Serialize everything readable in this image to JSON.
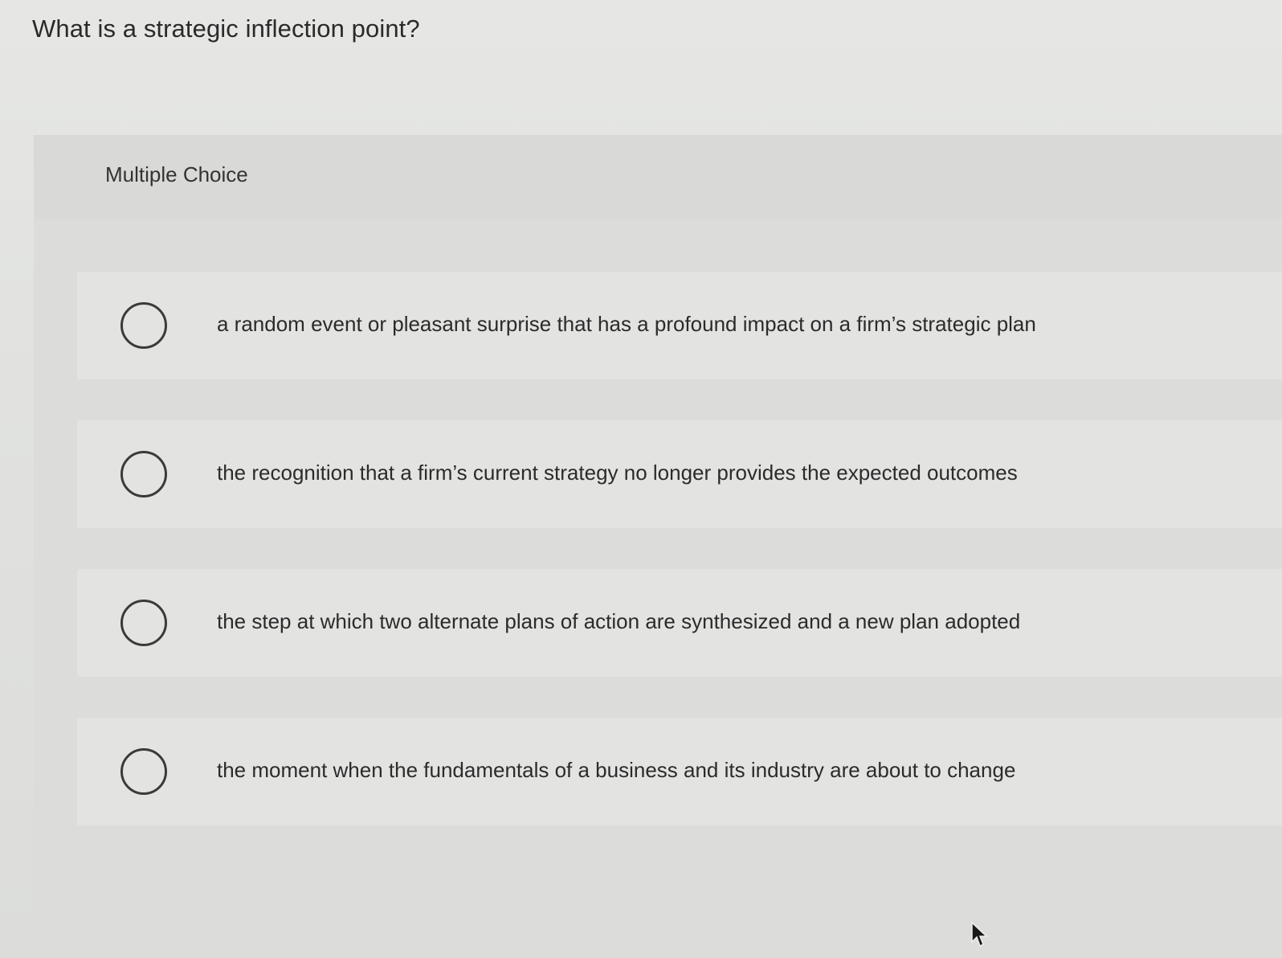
{
  "question": {
    "text": "What is a strategic inflection point?"
  },
  "panel": {
    "title": "Multiple Choice",
    "options": [
      {
        "label": "a random event or pleasant surprise that has a profound impact on a firm’s strategic plan"
      },
      {
        "label": "the recognition that a firm’s current strategy no longer provides the expected outcomes"
      },
      {
        "label": "the step at which two alternate plans of action are synthesized and a new plan adopted"
      },
      {
        "label": "the moment when the fundamentals of a business and its industry are about to change"
      }
    ]
  },
  "icons": {
    "radio": "radio-unchecked-icon",
    "pointer": "mouse-pointer-icon"
  }
}
